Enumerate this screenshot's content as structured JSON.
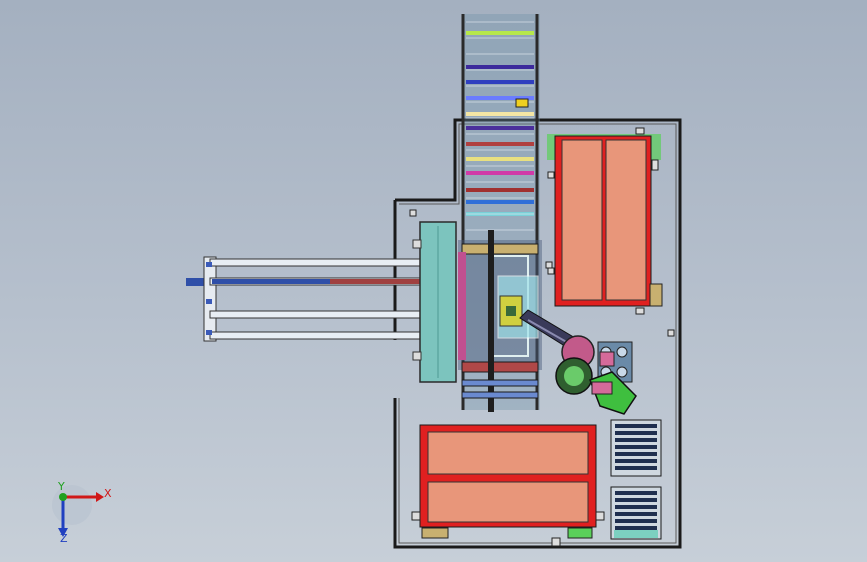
{
  "viewport": {
    "background_top": "#a4b0c0",
    "background_bottom": "#c7cfd8"
  },
  "triad": {
    "x_label": "X",
    "y_label": "Y",
    "z_label": "Z",
    "x_color": "#d01818",
    "y_color": "#20a020",
    "z_color": "#2040c0"
  },
  "colors": {
    "frame": "#1a1a1a",
    "pallet_red": "#e02020",
    "pallet_fill": "#e8967a",
    "conveyor_teal": "#7cc4be",
    "robot_green": "#3fbf3f",
    "robot_pink": "#d46a9a",
    "rail": "#e8eef4"
  },
  "conveyor_stripes": [
    "#b6e84a",
    "#3c2a9c",
    "#2f3fbf",
    "#6a7cff",
    "#f4e6a4",
    "#4a2f9c",
    "#b04040",
    "#e8e080",
    "#d03aa8",
    "#a03030",
    "#2f6fd8",
    "#7ad0d8"
  ]
}
